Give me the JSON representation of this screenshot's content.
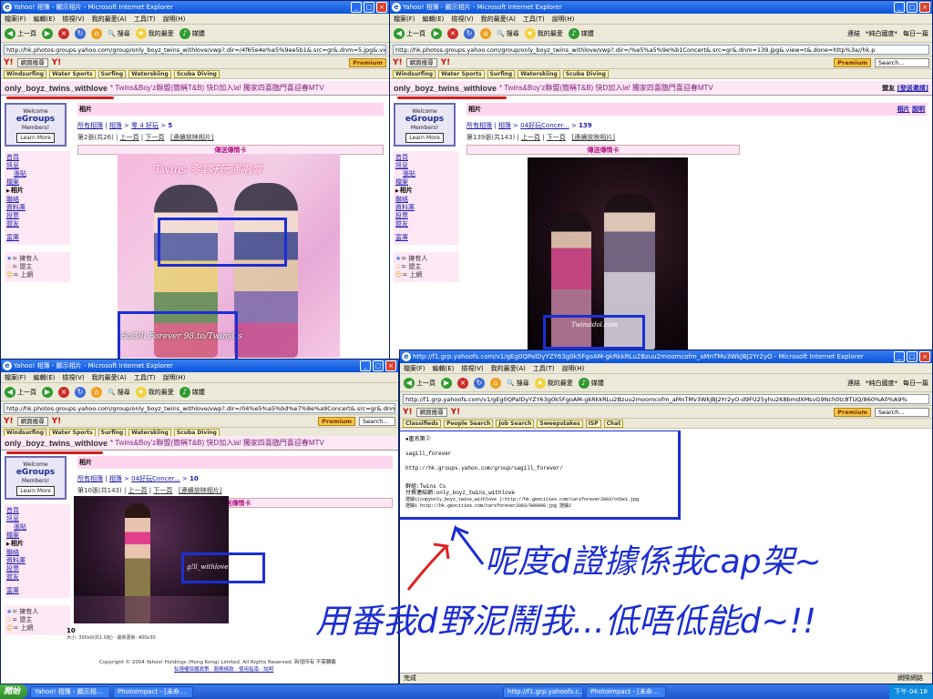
{
  "shared": {
    "ie_title_suffix": "Microsoft Internet Explorer",
    "menu": [
      "檔案(F)",
      "編輯(E)",
      "檢視(V)",
      "我的最愛(A)",
      "工具(T)",
      "說明(H)"
    ],
    "toolbar": {
      "back": "上一頁",
      "search": "搜尋",
      "favorites": "我的最愛",
      "media": "媒體"
    },
    "yahoo_search_button": "網頁搜尋",
    "premium": "Premium",
    "search_placeholder": "Search...",
    "link_buttons": [
      "Windsurfing",
      "Water Sports",
      "Surfing",
      "Waterskiing",
      "Scuba Diving"
    ],
    "group_name": "only_boyz_twins_withlove",
    "group_desc": "* Twins&Boy'z聯盟(簡稱T&B) 快D加入la! 獨家四喜臨門喜迎春MTV",
    "egroups": {
      "l1": "Welcome",
      "l2": "eGroups",
      "l3": "Members!",
      "l4": "Learn More"
    },
    "sidebar": [
      "首頁",
      "訊息",
      "張貼",
      "檔案",
      "相片",
      "聯絡",
      "資料庫",
      "投票",
      "盟友",
      "富庫"
    ],
    "legend": [
      "= 擁有人",
      "= 盟主",
      "= 上網"
    ],
    "photo_heading": "相片",
    "send_card": "傳送傳情卡",
    "crumb_root": "所有相簿",
    "crumb_album": "相簿",
    "prev": "上一頁",
    "next": "下一頁",
    "slideshow": "[連續放映相片]"
  },
  "win1": {
    "title": "Yahoo! 相簿 - 顯示相片 - Microsoft Internet Explorer",
    "address": "http://hk.photos.groups.yahoo.com/group/only_boyz_twins_withlove/vwp?.dir=/4f65e4e%e5%9ee5b1&.src=gr&.dnm=5.jpg&.view=t&.d",
    "crumb_album_name": "零 4 好玩",
    "crumb_page": "5",
    "count": "第2張(共26)",
    "photo_caption": "Twins 零4好玩演唱會",
    "watermark": "SaGill Forever 98.to/TwinsCs"
  },
  "win2": {
    "title": "Yahoo! 相簿 - 顯示相片 - Microsoft Internet Explorer",
    "address": "http://hk.photos.groups.yahoo.com/group/only_boyz_twins_withlove/vwp?.dir=/%e5%a5%9e%b1Concert&.src=gr&.dnm=139.jpg&.view=t&.done=http%3a//hk.p",
    "topright": [
      "盟友",
      "[發送邀請]"
    ],
    "links": [
      "相片",
      "說明"
    ],
    "crumb_album_name": "04好玩Concer...",
    "crumb_page": "139",
    "count": "第139張(共143)",
    "watermark": "Twinsidol.com",
    "addr_right": [
      "連結",
      "*純白國度*",
      "每日一篇"
    ]
  },
  "win3": {
    "title": "Yahoo! 相簿 - 顯示相片 - Microsoft Internet Explorer",
    "address": "http://hk.photos.groups.yahoo.com/group/only_boyz_twins_withlove/vwp?.dir=/04%e5%a5%bd%e7%8e%a9Concert&.src=gr&.dnm=10.jpg&.view=t&.done=htt",
    "crumb_album_name": "04好玩Concer...",
    "crumb_page": "10",
    "count": "第10張(共143)",
    "watermark": "g!ll_withlove",
    "photo_number": "10",
    "photo_info": "大小: 300x0(共1.0兆) · 最新更新: 400x30",
    "footer": "Copyright © 2004 Yahoo! Holdings (Hong Kong) Limited. All Rights Reserved.    新增所有 不需轉載",
    "footer2": "私隱權保護政策 · 服務條款 · 使用指南 · 說明"
  },
  "win4": {
    "title": "http://f1.grp.yahoofs.com/v1/gEg0QPalDyYZY63g0k5FgoAM-gkRkkRLu2Bzuu2moomcofm_aMnTMv3WkJBJ2Yr2yO - Microsoft Internet Explorer",
    "address": "http://f1.grp.yahoofs.com/v1/gEg0QPalDyYZY63g0k5FgoAM-gkRkkRLu2Bzuu2moomcofm_aMnTMv3WkJBJ2Yr2yO-d9FU25yhu2K8bmdXMsvG9Nch0tc8TUQ/860%A0%A9%",
    "links2": [
      "Classifieds",
      "People Search",
      "Job Search",
      "Sweepstakes",
      "ISP",
      "Chat"
    ],
    "lines": [
      "●匿名第②",
      "",
      "sagill_forever",
      "",
      "http://hk.groups.yahoo.com/group/sagill_forever/",
      "",
      "",
      "群組:Twins Cs",
      "付費連結網:only_boyz_twins_withlove",
      "證據1(copyonly_boyz_twins_withlove ):http://hk.geocities.com/carsforever2003/otbe1.jpg",
      "證據1 http://hk.geocities.com/carsforever2003/000000.jpg 證據2"
    ],
    "status": "完成",
    "status_right": "網際網路"
  },
  "annotation": {
    "line1": "呢度d證據係我cap架~",
    "line2": "用番我d野泥鬧我...低唔低能d~!!"
  },
  "taskbar": {
    "start": "開始",
    "tasks": [
      "Yahoo! 相簿 - 顯示相...",
      "PhotoImpact - [未命...",
      "http://f1.grp.yahoofs.c...",
      "PhotoImpact - [未命..."
    ],
    "clock": "下午 04:18"
  },
  "colors": {
    "annotation_blue": "#1c2ed0",
    "highlight_blue": "#1b2fd4",
    "underline_red": "#d91b1b",
    "pink_bg": "#ffe8f6"
  }
}
